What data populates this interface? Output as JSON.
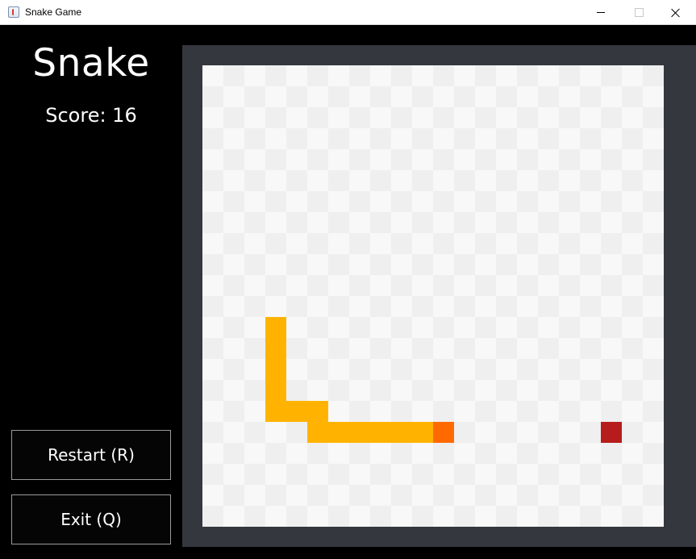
{
  "window": {
    "title": "Snake Game",
    "controls": [
      "minimize",
      "maximize",
      "close"
    ]
  },
  "sidebar": {
    "title": "Snake",
    "score_text": "Score: 16",
    "restart_label": "Restart (R)",
    "exit_label": "Exit (Q)"
  },
  "game": {
    "grid_cols": 22,
    "grid_rows": 22,
    "colors": {
      "frame": "#34373e",
      "light_tile": "#f8f8f8",
      "dark_tile": "#efefef",
      "snake_body": "#ffb300",
      "snake_head": "#ff6a00",
      "food": "#b71c1c"
    },
    "snake": [
      {
        "col": 11,
        "row": 17
      },
      {
        "col": 10,
        "row": 17
      },
      {
        "col": 9,
        "row": 17
      },
      {
        "col": 8,
        "row": 17
      },
      {
        "col": 7,
        "row": 17
      },
      {
        "col": 6,
        "row": 17
      },
      {
        "col": 5,
        "row": 17
      },
      {
        "col": 5,
        "row": 16
      },
      {
        "col": 4,
        "row": 16
      },
      {
        "col": 3,
        "row": 16
      },
      {
        "col": 3,
        "row": 15
      },
      {
        "col": 3,
        "row": 14
      },
      {
        "col": 3,
        "row": 13
      },
      {
        "col": 3,
        "row": 12
      }
    ],
    "food": {
      "col": 19,
      "row": 17
    }
  }
}
